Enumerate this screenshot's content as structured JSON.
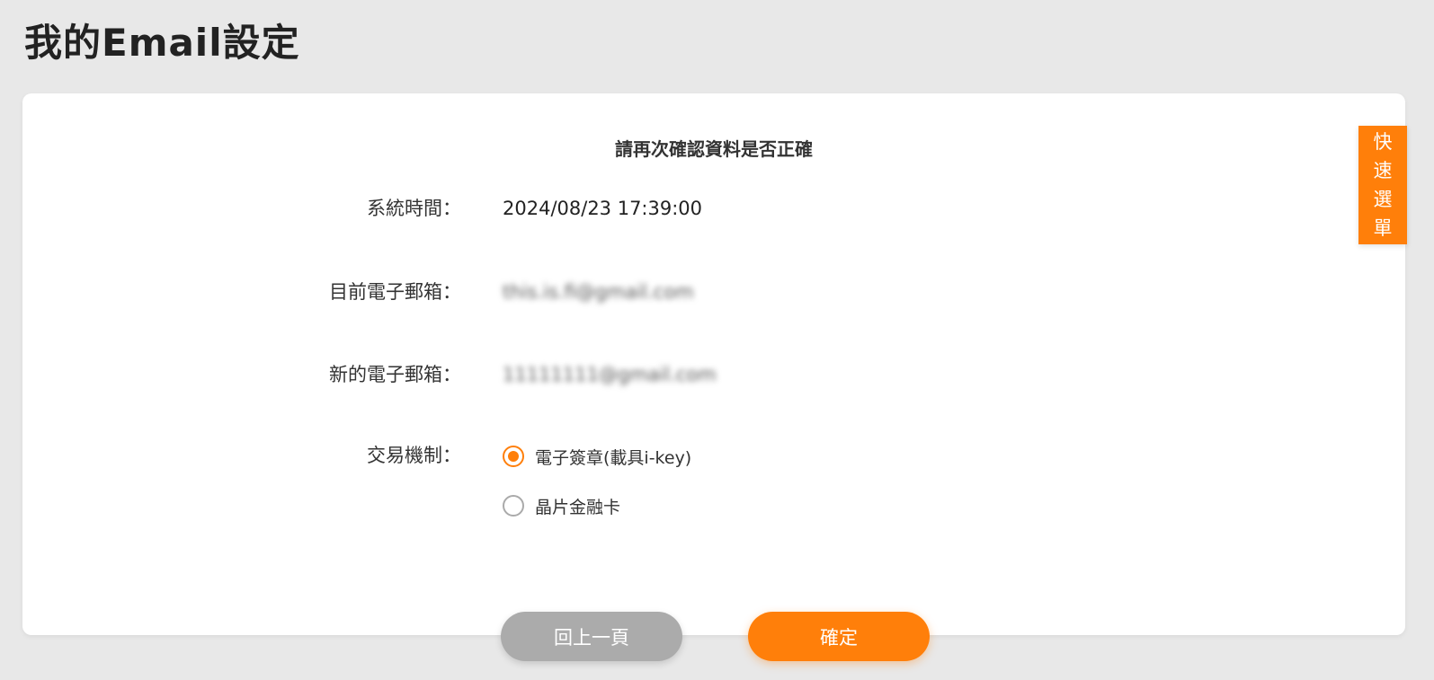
{
  "page": {
    "title": "我的Email設定"
  },
  "card": {
    "heading": "請再次確認資料是否正確",
    "fields": [
      {
        "label": "系統時間：",
        "value": "2024/08/23 17:39:00"
      },
      {
        "label": "目前電子郵箱：",
        "value": "this.is.fi@gmail.com"
      },
      {
        "label": "新的電子郵箱：",
        "value": "11111111@gmail.com"
      }
    ],
    "mechanism": {
      "label": "交易機制：",
      "options": [
        {
          "label": "電子簽章(載具i-key)",
          "selected": true
        },
        {
          "label": "晶片金融卡",
          "selected": false
        }
      ]
    }
  },
  "buttons": {
    "back_label": "回上一頁",
    "confirm_label": "確定"
  },
  "quick_menu": {
    "chars": [
      "快",
      "速",
      "選",
      "單"
    ]
  },
  "colors": {
    "accent": "#ff7f0a",
    "background": "#e8e8e8",
    "back_button": "#ababab"
  }
}
